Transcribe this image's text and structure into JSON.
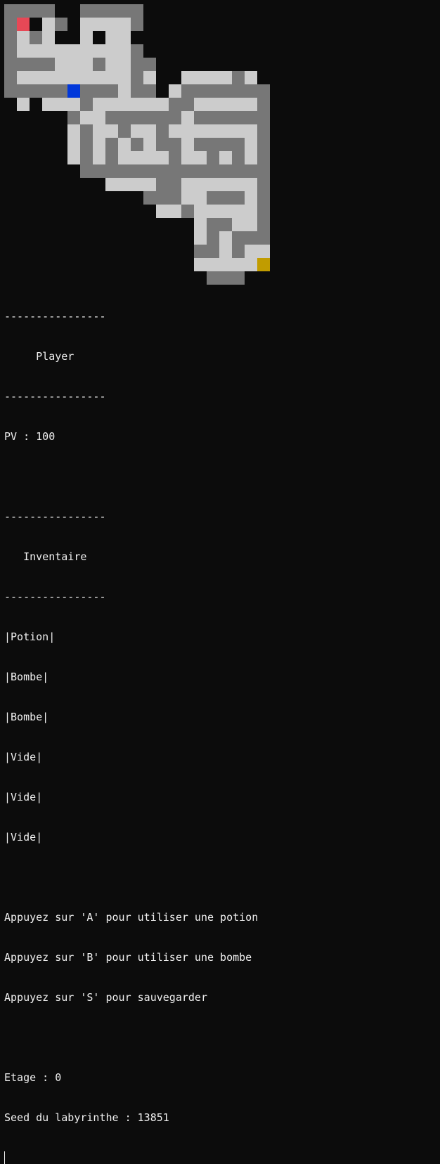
{
  "maze": {
    "rows": [
      "AAAA..AAAAA..........",
      "AR.LA.LLLLA..........",
      "ALAL..L.LL...........",
      "ALLLLLLLLLA..........",
      "AAAALLLALLAA.........",
      "ALLLLLLLLLAL..LLLLAL.",
      "AAAAAPAAALAA.LAAAAAAA",
      ".L.LLLALLLLLLAALLLLLA",
      ".....ALLAAAAAALAAAAAA",
      ".....LALLALLALLLLLLLA",
      ".....LALALALAALAAAALA",
      ".....LALALLLLALLALALA",
      "......AAAAAAAAAAAAAAA",
      "........LLLLAALLLLLLA",
      "...........AAALLAAALA",
      "............LLALLLLLA",
      "...............LAALLA",
      "...............LALAAA",
      "...............AALALL",
      "...............LLLLLG",
      "................AAA.."
    ],
    "colors": {
      "wall": "#777777",
      "floor": "#cccccc",
      "start": "#e74856",
      "player": "#0037da",
      "goal": "#c19c00"
    }
  },
  "terminal": {
    "lines": [
      "----------------",
      "     Player",
      "----------------",
      "PV : 100",
      "",
      "----------------",
      "   Inventaire",
      "----------------",
      "|Potion|",
      "|Bombe|",
      "|Bombe|",
      "|Vide|",
      "|Vide|",
      "|Vide|",
      "",
      "Appuyez sur 'A' pour utiliser une potion",
      "Appuyez sur 'B' pour utiliser une bombe",
      "Appuyez sur 'S' pour sauvegarder",
      "",
      "Etage : 0",
      "Seed du labyrinthe : 13851"
    ]
  }
}
